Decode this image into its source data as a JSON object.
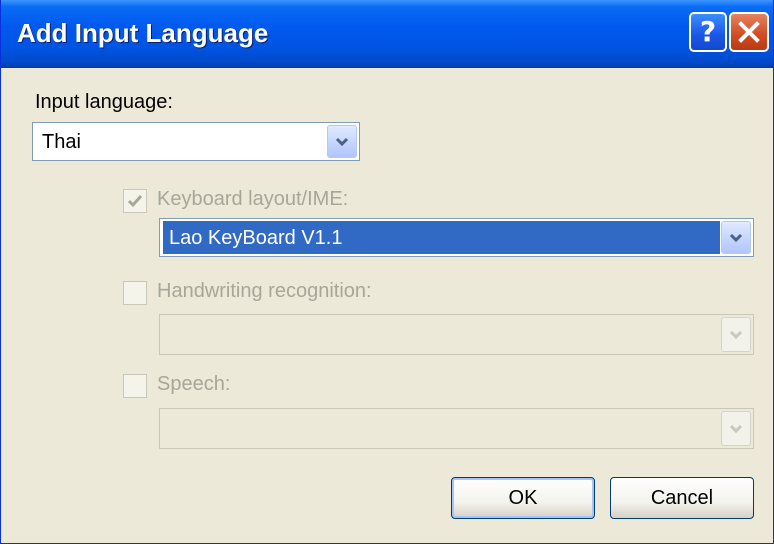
{
  "window": {
    "title": "Add Input Language"
  },
  "titlebar": {
    "help_glyph": "?",
    "help_icon": "help-icon",
    "close_icon": "close-icon"
  },
  "input_language": {
    "label": "Input language:",
    "value": "Thai",
    "enabled": true
  },
  "keyboard_layout": {
    "label": "Keyboard layout/IME:",
    "checked": true,
    "enabled": false,
    "value": "Lao KeyBoard V1.1",
    "value_selected": true
  },
  "handwriting": {
    "label": "Handwriting recognition:",
    "checked": false,
    "enabled": false,
    "value": ""
  },
  "speech": {
    "label": "Speech:",
    "checked": false,
    "enabled": false,
    "value": ""
  },
  "buttons": {
    "ok": "OK",
    "cancel": "Cancel"
  },
  "colors": {
    "titlebar": "#0054E3",
    "face": "#ECE9D8",
    "selection": "#316AC5",
    "disabled_text": "#A7A699"
  }
}
